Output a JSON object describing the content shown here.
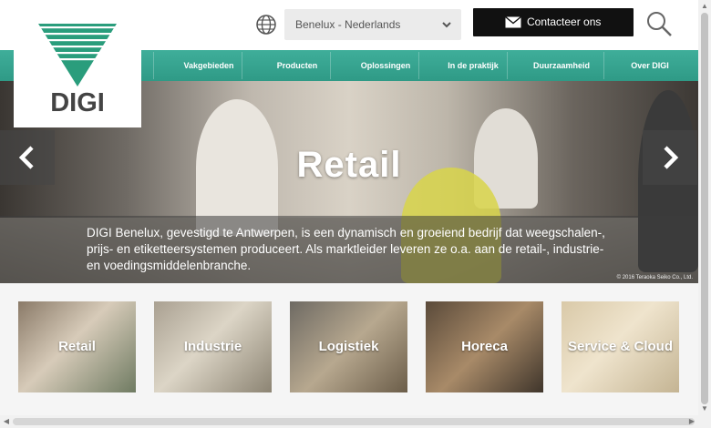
{
  "header": {
    "region_selector": {
      "value": "Benelux - Nederlands"
    },
    "contact_button": {
      "label": "Contacteer ons"
    }
  },
  "logo": {
    "text": "DIGI"
  },
  "nav": {
    "items": [
      {
        "label": "Vakgebieden"
      },
      {
        "label": "Producten"
      },
      {
        "label": "Oplossingen"
      },
      {
        "label": "In de praktijk"
      },
      {
        "label": "Duurzaamheid"
      },
      {
        "label": "Over DIGI"
      }
    ]
  },
  "hero": {
    "title": "Retail",
    "caption": "DIGI Benelux, gevestigd te Antwerpen, is een dynamisch en groeiend bedrijf dat weegschalen-, prijs- en etiketteersystemen produceert. Als marktleider leveren ze o.a. aan de retail-, industrie- en voedingsmiddelenbranche.",
    "copyright": "© 2016 Teraoka Seiko Co., Ltd."
  },
  "tiles": [
    {
      "label": "Retail"
    },
    {
      "label": "Industrie"
    },
    {
      "label": "Logistiek"
    },
    {
      "label": "Horeca"
    },
    {
      "label": "Service & Cloud"
    }
  ],
  "colors": {
    "nav_green": "#3fae9a",
    "logo_green": "#2a9d7c",
    "contact_bg": "#111111"
  }
}
